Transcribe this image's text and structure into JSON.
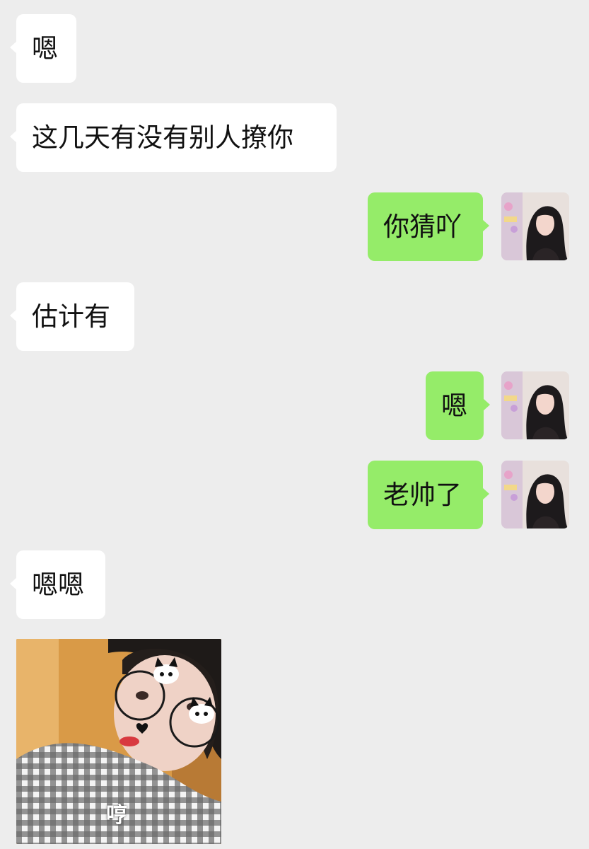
{
  "chat": {
    "messages": [
      {
        "from": "other",
        "text": "嗯"
      },
      {
        "from": "other",
        "text": "这几天有没有别人撩你"
      },
      {
        "from": "me",
        "text": "你猜吖"
      },
      {
        "from": "other",
        "text": "估计有"
      },
      {
        "from": "me",
        "text": "嗯"
      },
      {
        "from": "me",
        "text": "老帅了"
      },
      {
        "from": "other",
        "text": "嗯嗯"
      },
      {
        "from": "other",
        "type": "image",
        "caption": "哼"
      }
    ]
  },
  "colors": {
    "background": "#ededed",
    "incoming_bubble": "#ffffff",
    "outgoing_bubble": "#95ec69",
    "text": "#111111"
  },
  "icons": {
    "my_avatar": "user-avatar-photo",
    "sticker": "dog-ear-sticker-icon"
  }
}
